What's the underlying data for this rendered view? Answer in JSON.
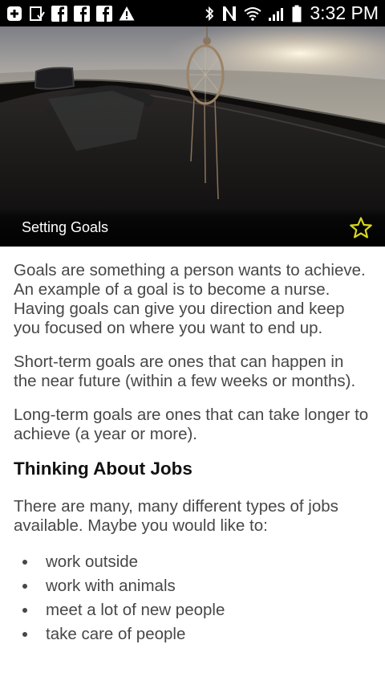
{
  "status_bar": {
    "time": "3:32 PM",
    "left_icons": [
      "add-notification-icon",
      "download-icon",
      "facebook-icon",
      "facebook-icon",
      "facebook-icon",
      "warning-icon"
    ],
    "right_icons": [
      "bluetooth-icon",
      "nfc-icon",
      "wifi-icon",
      "signal-icon",
      "battery-icon"
    ]
  },
  "hero": {
    "title": "Setting Goals",
    "favorite_icon": "star-outline-icon",
    "favorite_color": "#d7d81e"
  },
  "article": {
    "paragraphs": [
      "Goals are something a person wants to achieve. An example of a goal is to become a nurse. Having goals can give you direction and keep you focused on where you want to end up.",
      "Short-term goals are ones that can happen in the near future (within a few weeks or months).",
      "Long-term goals are ones that can take longer to achieve (a year or more)."
    ],
    "section_heading": "Thinking About Jobs",
    "section_intro": "There are many, many different types of jobs available. Maybe you would like to:",
    "bullets": [
      "work outside",
      "work with animals",
      "meet a lot of new people",
      "take care of people"
    ]
  },
  "colors": {
    "status_bar_bg": "#000000",
    "body_text": "#474747",
    "heading_text": "#111111"
  }
}
